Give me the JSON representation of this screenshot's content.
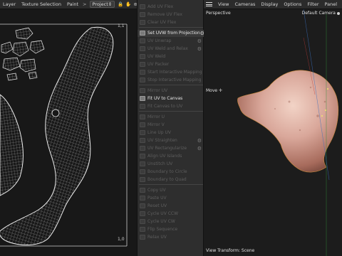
{
  "uv_editor": {
    "menu": [
      "Layer",
      "Texture Selection",
      "Paint"
    ],
    "chevron": ">",
    "projection_select": "Project",
    "corner_top": "1,1",
    "corner_bottom": "1,0"
  },
  "commands": [
    {
      "label": "Add UV Flex",
      "state": "dim"
    },
    {
      "label": "Remove UV Flex",
      "state": "dim"
    },
    {
      "label": "Clear UV Flex",
      "state": "dim"
    },
    {
      "label": "Set UVW from Projection",
      "state": "highlight",
      "gear": true
    },
    {
      "label": "UV Unwrap",
      "state": "dim",
      "gear": true
    },
    {
      "label": "UV Weld and Relax",
      "state": "dim",
      "gear": true
    },
    {
      "label": "UV Weld",
      "state": "dim"
    },
    {
      "label": "UV Packer",
      "state": "dim"
    },
    {
      "label": "Start Interactive Mapping",
      "state": "dim"
    },
    {
      "label": "Stop Interactive Mapping",
      "state": "dim"
    },
    {
      "label": "Mirror UV",
      "state": "dim"
    },
    {
      "label": "Fit UV to Canvas",
      "state": "bright"
    },
    {
      "label": "Fit Canvas to UV",
      "state": "dim"
    },
    {
      "label": "Mirror U",
      "state": "dim"
    },
    {
      "label": "Mirror V",
      "state": "dim"
    },
    {
      "label": "Line Up UV",
      "state": "dim"
    },
    {
      "label": "UV Straighten",
      "state": "dim",
      "gear": true
    },
    {
      "label": "UV Rectangularize",
      "state": "dim",
      "gear": true
    },
    {
      "label": "Align UV Islands",
      "state": "dim"
    },
    {
      "label": "Unstitch UV",
      "state": "dim"
    },
    {
      "label": "Boundary to Circle",
      "state": "dim"
    },
    {
      "label": "Boundary to Quad",
      "state": "dim"
    },
    {
      "label": "Copy UV",
      "state": "dim"
    },
    {
      "label": "Paste UV",
      "state": "dim"
    },
    {
      "label": "Reset UV",
      "state": "dim"
    },
    {
      "label": "Cycle UV CCW",
      "state": "dim"
    },
    {
      "label": "Cycle UV CW",
      "state": "dim"
    },
    {
      "label": "Flip Sequence",
      "state": "dim"
    },
    {
      "label": "Relax UV",
      "state": "dim"
    }
  ],
  "viewport": {
    "menu": [
      "View",
      "Cameras",
      "Display",
      "Options",
      "Filter",
      "Panel"
    ],
    "title": "Perspective",
    "camera": "Default Camera",
    "camera_icon": "dot-icon",
    "tool": "Move",
    "tool_icon": "move-cross-icon",
    "footer": "View Transform: Scene"
  },
  "colors": {
    "highlight_row": "#3a3a3a",
    "mesh_white": "#e6e6e6",
    "skin_tone": "#d9a79a"
  }
}
